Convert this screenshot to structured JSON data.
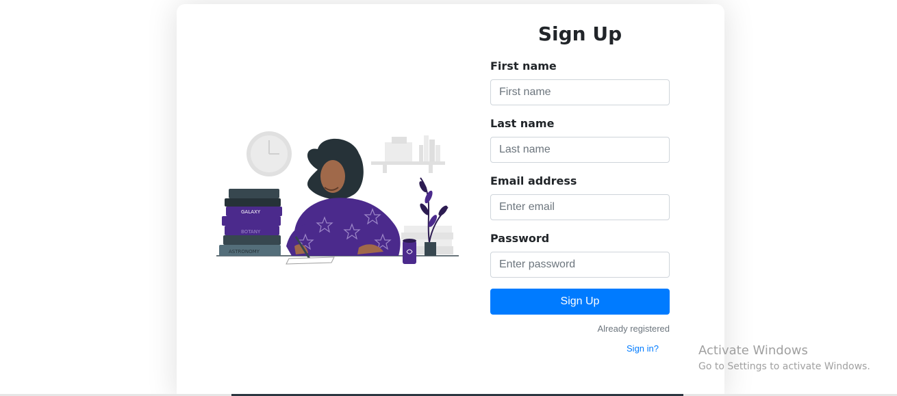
{
  "form": {
    "title": "Sign Up",
    "fields": [
      {
        "label": "First name",
        "placeholder": "First name",
        "value": ""
      },
      {
        "label": "Last name",
        "placeholder": "Last name",
        "value": ""
      },
      {
        "label": "Email address",
        "placeholder": "Enter email",
        "value": ""
      },
      {
        "label": "Password",
        "placeholder": "Enter password",
        "value": ""
      }
    ],
    "submit_label": "Sign Up",
    "already_registered_text": "Already registered",
    "signin_link_text": "Sign in?"
  },
  "illustration": {
    "book_labels": [
      "GALAXY",
      "BOTANY",
      "ASTRONOMY"
    ]
  },
  "watermark": {
    "title": "Activate Windows",
    "subtitle": "Go to Settings to activate Windows."
  },
  "colors": {
    "primary": "#007bff",
    "illustration_purple": "#4b2a8c",
    "illustration_dark": "#37474f"
  }
}
